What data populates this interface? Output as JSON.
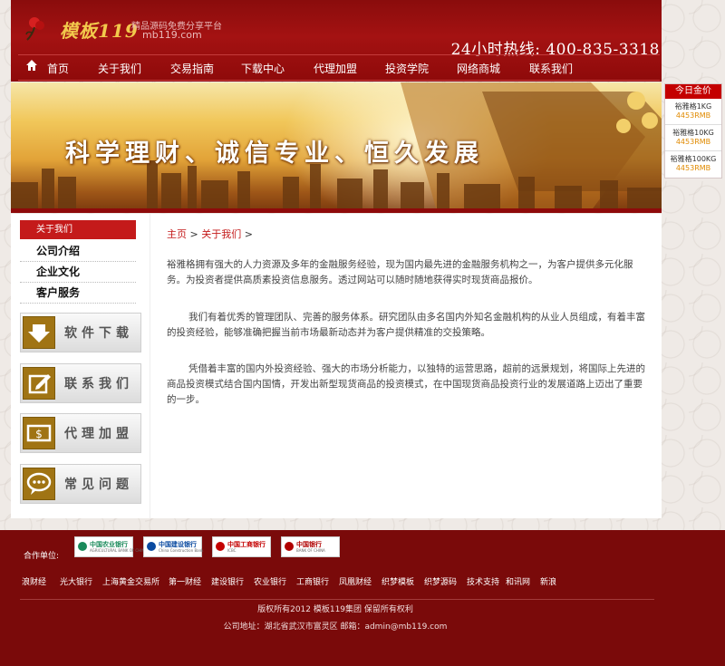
{
  "header": {
    "logo_text": "模板119",
    "slogan": "精品源码免费分享平台",
    "domain": "mb119.com",
    "hotline": "24小时热线: 400-835-3318"
  },
  "nav": [
    "首页",
    "关于我们",
    "交易指南",
    "下载中心",
    "代理加盟",
    "投资学院",
    "网络商城",
    "联系我们"
  ],
  "banner": {
    "text": "科学理财、诚信专业、恒久发展"
  },
  "gold_price": {
    "title": "今日金价",
    "items": [
      {
        "name": "裕雅格1KG",
        "price": "4453RMB"
      },
      {
        "name": "裕雅格10KG",
        "price": "4453RMB"
      },
      {
        "name": "裕雅格100KG",
        "price": "4453RMB"
      }
    ]
  },
  "sidebar": {
    "header": "关于我们",
    "items": [
      "公司介绍",
      "企业文化",
      "客户服务"
    ],
    "buttons": [
      "软件下载",
      "联系我们",
      "代理加盟",
      "常见问题"
    ]
  },
  "breadcrumb": {
    "home": "主页",
    "sep": ">",
    "current": "关于我们",
    "tail": ">"
  },
  "article": [
    "裕雅格拥有强大的人力资源及多年的金融服务经验，现为国内最先进的金融服务机构之一，为客户提供多元化服务。为投资者提供高质素投资信息服务。透过网站可以随时随地获得实时现货商品报价。",
    "我们有着优秀的管理团队、完善的服务体系。研究团队由多名国内外知名金融机构的从业人员组成，有着丰富的投资经验，能够准确把握当前市场最新动态并为客户提供精准的交投策略。",
    "凭借着丰富的国内外投资经验、强大的市场分析能力，以独特的运营思路，超前的远景规划，将国际上先进的商品投资模式结合国内国情，开发出新型现货商品的投资模式，在中国现货商品投资行业的发展道路上迈出了重要的一步。"
  ],
  "footer": {
    "partner_label": "合作单位:",
    "partners": [
      {
        "name": "中国农业银行",
        "en": "AGRICULTURAL BANK OF CHINA",
        "color": "#1a8a5a"
      },
      {
        "name": "中国建设银行",
        "en": "China Construction Bank",
        "color": "#0a4aa0"
      },
      {
        "name": "中国工商银行",
        "en": "ICBC",
        "color": "#c40000"
      },
      {
        "name": "中国银行",
        "en": "BANK OF CHINA",
        "color": "#b00000"
      }
    ],
    "links": [
      "浪财经",
      "光大银行",
      "上海黄金交易所",
      "第一财经",
      "建设银行",
      "农业银行",
      "工商银行",
      "凤凰财经",
      "织梦模板",
      "织梦源码",
      "技术支持",
      "和讯网",
      "新浪"
    ],
    "copyright": "版权所有2012 模板119集团 保留所有权利",
    "address": "公司地址：湖北省武汉市富灵区 邮箱：admin@mb119.com"
  }
}
